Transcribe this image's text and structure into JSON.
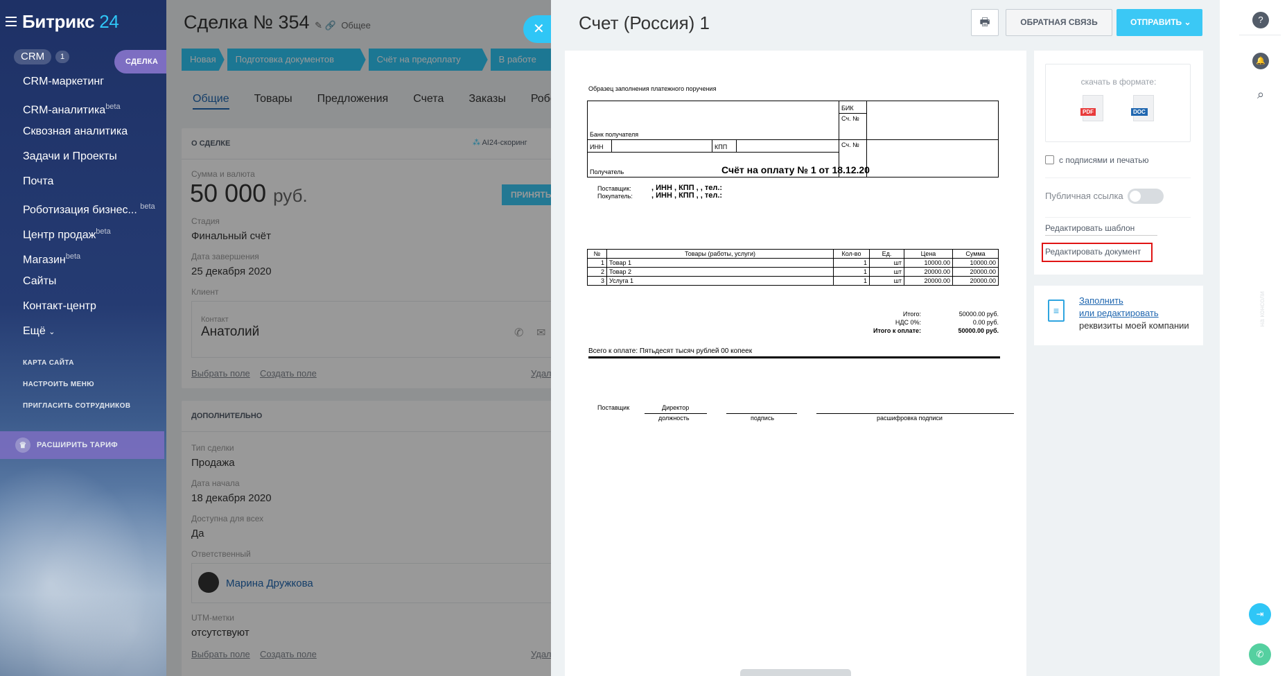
{
  "sidebar": {
    "logo_main": "Битрикс",
    "logo_num": "24",
    "crm": "CRM",
    "crm_count": "1",
    "deal_tab": "СДЕЛКА",
    "items": [
      {
        "label": "CRM-маркетинг",
        "sup": ""
      },
      {
        "label": "CRM-аналитика",
        "sup": "beta"
      },
      {
        "label": "Сквозная аналитика",
        "sup": ""
      },
      {
        "label": "Задачи и Проекты",
        "sup": ""
      },
      {
        "label": "Почта",
        "sup": ""
      },
      {
        "label": "Роботизация бизнес...",
        "sup": "beta"
      },
      {
        "label": "Центр продаж",
        "sup": "beta"
      },
      {
        "label": "Магазин",
        "sup": "beta"
      },
      {
        "label": "Сайты",
        "sup": ""
      },
      {
        "label": "Контакт-центр",
        "sup": ""
      },
      {
        "label": "Ещё",
        "sup": ""
      }
    ],
    "links": [
      "КАРТА САЙТА",
      "НАСТРОИТЬ МЕНЮ",
      "ПРИГЛАСИТЬ СОТРУДНИКОВ"
    ],
    "upgrade": "РАСШИРИТЬ ТАРИФ"
  },
  "deal": {
    "title": "Сделка №  354",
    "category": "Общее",
    "stages": [
      "Новая",
      "Подготовка документов",
      "Счёт на предоплату",
      "В работе"
    ],
    "tabs": [
      "Общие",
      "Товары",
      "Предложения",
      "Счета",
      "Заказы",
      "Роботы"
    ],
    "about": "О СДЕЛКЕ",
    "scoring": "AI24-скоринг",
    "amount_label": "Сумма и валюта",
    "amount": "50 000",
    "currency": "руб.",
    "accept": "ПРИНЯТЬ",
    "stage_label": "Стадия",
    "stage_value": "Финальный счёт",
    "close_label": "Дата завершения",
    "close_value": "25 декабря 2020",
    "client_label": "Клиент",
    "contact_label": "Контакт",
    "contact_value": "Анатолий",
    "choose_field": "Выбрать поле",
    "create_field": "Создать поле",
    "delete": "Удал",
    "extra": "ДОПОЛНИТЕЛЬНО",
    "type_label": "Тип сделки",
    "type_value": "Продажа",
    "start_label": "Дата начала",
    "start_value": "18 декабря 2020",
    "public_label": "Доступна для всех",
    "public_value": "Да",
    "resp_label": "Ответственный",
    "resp_value": "Марина Дружкова",
    "utm_label": "UTM-метки",
    "utm_value": "отсутствуют"
  },
  "slider": {
    "title": "Счет (Россия) 1",
    "feedback": "ОБРАТНАЯ СВЯЗЬ",
    "send": "ОТПРАВИТЬ",
    "download_label": "скачать в формате:",
    "pdf": "PDF",
    "doc": "DOC",
    "signatures": "с подписями и печатью",
    "public_link": "Публичная ссылка",
    "edit_template": "Редактировать шаблон",
    "edit_document": "Редактировать документ",
    "fill": "Заполнить",
    "or_edit": "или редактировать",
    "requisites": "реквизиты моей компании"
  },
  "doc": {
    "sample": "Образец заполнения платежного поручения",
    "bik": "БИК",
    "acc": "Сч. №",
    "bank": "Банк получателя",
    "inn": "ИНН",
    "kpp": "КПП",
    "receiver": "Получатель",
    "heading": "Счёт на оплату № 1 от 18.12.20",
    "supplier_label": "Поставщик:",
    "supplier_value": ", ИНН , КПП , , тел.:",
    "buyer_label": "Покупатель:",
    "buyer_value": ", ИНН , КПП , , тел.:",
    "cols": [
      "№",
      "Товары (работы, услуги)",
      "Кол-во",
      "Ед.",
      "Цена",
      "Сумма"
    ],
    "rows": [
      [
        "1",
        "Товар 1",
        "1",
        "шт",
        "10000.00",
        "10000.00"
      ],
      [
        "2",
        "Товар 2",
        "1",
        "шт",
        "20000.00",
        "20000.00"
      ],
      [
        "3",
        "Услуга 1",
        "1",
        "шт",
        "20000.00",
        "20000.00"
      ]
    ],
    "total_label": "Итого:",
    "total_value": "50000.00 руб.",
    "vat_label": "НДС 0%:",
    "vat_value": "0.00 руб.",
    "topay_label": "Итого к оплате:",
    "topay_value": "50000.00 руб.",
    "words": "Всего к оплате: Пятьдесят тысяч рублей 00 копеек",
    "sign_supplier": "Поставщик",
    "sign_director": "Директор",
    "sign_position": "должность",
    "sign_sign": "подпись",
    "sign_decode": "расшифровка подписи"
  },
  "rail": {
    "vertical": "на консоли"
  }
}
